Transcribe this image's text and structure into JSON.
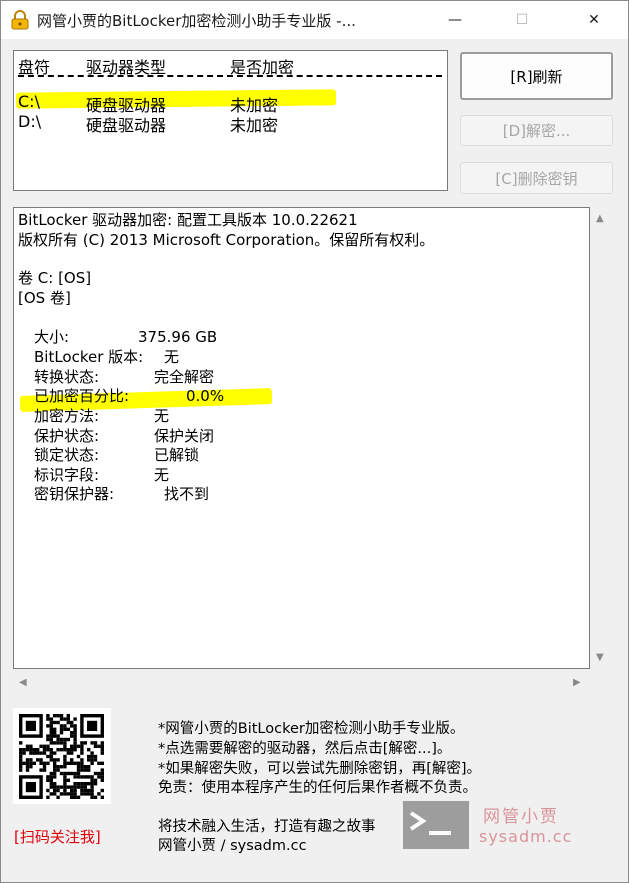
{
  "window": {
    "title": "网管小贾的BitLocker加密检测小助手专业版 -...",
    "min_glyph": "—",
    "max_glyph": "☐",
    "close_glyph": "✕"
  },
  "drive_list": {
    "headers": [
      "盘符",
      "驱动器类型",
      "是否加密"
    ],
    "rows": [
      {
        "drive": "C:\\",
        "type": "硬盘驱动器",
        "encrypted": "未加密"
      },
      {
        "drive": "D:\\",
        "type": "硬盘驱动器",
        "encrypted": "未加密"
      }
    ]
  },
  "buttons": {
    "refresh": "[R]刷新",
    "decrypt": "[D]解密...",
    "delete_key": "[C]删除密钥"
  },
  "output": {
    "header1": "BitLocker 驱动器加密: 配置工具版本 10.0.22621",
    "header2": "版权所有 (C) 2013 Microsoft Corporation。保留所有权利。",
    "volume1": "卷 C: [OS]",
    "volume2": "[OS 卷]",
    "fields": [
      {
        "key": "大小:",
        "value": "375.96 GB"
      },
      {
        "key": "BitLocker 版本:",
        "value": "无"
      },
      {
        "key": "转换状态:",
        "value": "完全解密"
      },
      {
        "key": "已加密百分比:",
        "value": "0.0%"
      },
      {
        "key": "加密方法:",
        "value": "无"
      },
      {
        "key": "保护状态:",
        "value": "保护关闭"
      },
      {
        "key": "锁定状态:",
        "value": "已解锁"
      },
      {
        "key": "标识字段:",
        "value": "无"
      },
      {
        "key": "密钥保护器:",
        "value": "找不到"
      }
    ]
  },
  "footer": {
    "scan_label": "[扫码关注我]",
    "info_lines": [
      "*网管小贾的BitLocker加密检测小助手专业版。",
      "*点选需要解密的驱动器，然后点击[解密...]。",
      "*如果解密失败，可以尝试先删除密钥，再[解密]。",
      "免责：使用本程序产生的任何后果作者概不负责。"
    ],
    "slogan": "将技术融入生活，打造有趣之故事",
    "author": "网管小贾 / sysadm.cc"
  },
  "watermark": {
    "line1": "网管小贾",
    "line2": "sysadm.cc"
  },
  "colors": {
    "highlight": "#ffff00",
    "scan_label": "#e0000a",
    "watermark": "#d9949a"
  }
}
